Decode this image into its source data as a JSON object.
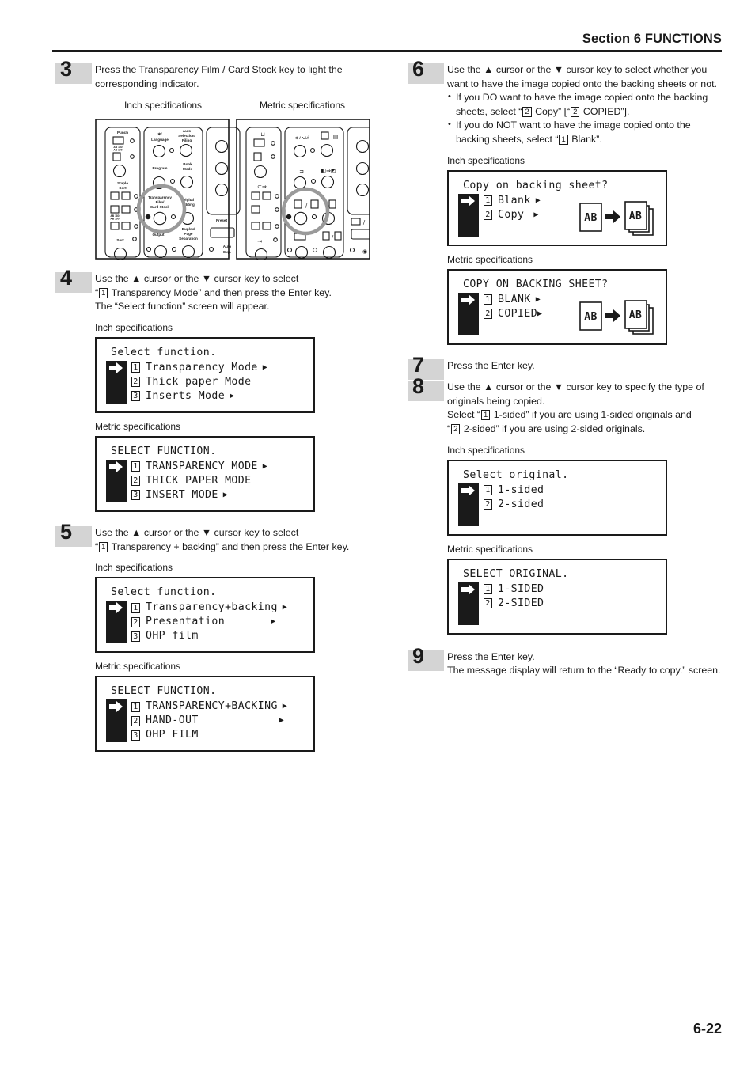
{
  "header": {
    "section_label": "Section 6  FUNCTIONS"
  },
  "footer": {
    "page_number": "6-22"
  },
  "captions": {
    "inch": "Inch specifications",
    "metric": "Metric specifications"
  },
  "steps": {
    "s3": {
      "number": "3",
      "text": "Press the Transparency Film / Card Stock key to light the corresponding indicator."
    },
    "s4": {
      "number": "4",
      "line1": "Use the ▲ cursor or the ▼ cursor key to select",
      "line2_pre": "“",
      "line2_key": "1",
      "line2_post": " Transparency Mode” and then press the Enter key.",
      "line3": "The “Select function” screen will appear."
    },
    "s5": {
      "number": "5",
      "line1": "Use the ▲ cursor or the ▼ cursor key to select",
      "line2_pre": "“",
      "line2_key": "1",
      "line2_post": " Transparency + backing” and then press the Enter key."
    },
    "s6": {
      "number": "6",
      "line1": "Use the ▲ cursor or the ▼ cursor key to select whether you want to have the image copied onto the backing sheets or not.",
      "bullet1_a": "If you DO want to have the image copied onto the backing sheets, select “",
      "bullet1_key1": "2",
      "bullet1_b": " Copy” [“",
      "bullet1_key2": "2",
      "bullet1_c": " COPIED”].",
      "bullet2_a": "If you do NOT want to have the image copied onto the backing sheets, select “",
      "bullet2_key1": "1",
      "bullet2_b": " Blank”."
    },
    "s7": {
      "number": "7",
      "text": "Press the Enter key."
    },
    "s8": {
      "number": "8",
      "line1": "Use the ▲ cursor or the ▼ cursor key to specify the type of originals being copied.",
      "line2_a": "Select “",
      "line2_key1": "1",
      "line2_b": " 1-sided” if you are using 1-sided originals and",
      "line3_a": "“",
      "line3_key1": "2",
      "line3_b": " 2-sided” if you are using 2-sided originals."
    },
    "s9": {
      "number": "9",
      "line1": "Press the Enter key.",
      "line2": "The message display will return to the “Ready to copy.” screen."
    }
  },
  "screens": {
    "select_function_inch": {
      "title": "Select function.",
      "rows": [
        {
          "key": "1",
          "label": "Transparency Mode",
          "arrow": true
        },
        {
          "key": "2",
          "label": "Thick paper Mode",
          "arrow": false
        },
        {
          "key": "3",
          "label": "Inserts Mode",
          "arrow": true
        }
      ]
    },
    "select_function_metric": {
      "title": "SELECT FUNCTION.",
      "rows": [
        {
          "key": "1",
          "label": "TRANSPARENCY MODE",
          "arrow": true
        },
        {
          "key": "2",
          "label": "THICK PAPER MODE",
          "arrow": false
        },
        {
          "key": "3",
          "label": "INSERT MODE",
          "arrow": true
        }
      ]
    },
    "select_transparency_inch": {
      "title": "Select function.",
      "rows": [
        {
          "key": "1",
          "label": "Transparency+backing",
          "arrow": true
        },
        {
          "key": "2",
          "label": "Presentation",
          "arrow": true
        },
        {
          "key": "3",
          "label": "OHP film",
          "arrow": false
        }
      ]
    },
    "select_transparency_metric": {
      "title": "SELECT FUNCTION.",
      "rows": [
        {
          "key": "1",
          "label": "TRANSPARENCY+BACKING",
          "arrow": true
        },
        {
          "key": "2",
          "label": "HAND-OUT",
          "arrow": true
        },
        {
          "key": "3",
          "label": "OHP FILM",
          "arrow": false
        }
      ]
    },
    "backing_inch": {
      "title": "Copy on backing sheet?",
      "rows": [
        {
          "key": "1",
          "label": "Blank",
          "arrow": true
        },
        {
          "key": "2",
          "label": "Copy",
          "arrow": true
        }
      ],
      "illustration_label": "AB"
    },
    "backing_metric": {
      "title": "COPY ON BACKING SHEET?",
      "rows": [
        {
          "key": "1",
          "label": "BLANK",
          "arrow": true
        },
        {
          "key": "2",
          "label": "COPIED",
          "arrow": true
        }
      ],
      "illustration_label": "AB"
    },
    "select_original_inch": {
      "title": "Select original.",
      "rows": [
        {
          "key": "1",
          "label": "1-sided",
          "arrow": false
        },
        {
          "key": "2",
          "label": "2-sided",
          "arrow": false
        }
      ]
    },
    "select_original_metric": {
      "title": "SELECT ORIGINAL.",
      "rows": [
        {
          "key": "1",
          "label": "1-SIDED",
          "arrow": false
        },
        {
          "key": "2",
          "label": "2-SIDED",
          "arrow": false
        }
      ]
    }
  },
  "control_panel": {
    "inch_labels": {
      "punch": "Punch",
      "staple_sort": "Staple\nSort",
      "sort": "Sort",
      "language": "✱/\nLanguage",
      "auto_selection": "Auto\nSelection/\nFiling",
      "program": "Program",
      "book_mode": "Book\nMode",
      "transparency": "Transparency\nFilm/\nCard Stock",
      "digital_editing": "Digital\nEditing",
      "output": "Output",
      "duplex": "Duplex/\nPage\nSeparation",
      "preset": "Preset",
      "auto_exposure": "Auto\nExp."
    },
    "metric_labels": {
      "language_icon": "✱ / AAA",
      "highlight_key_icon": "/"
    }
  }
}
